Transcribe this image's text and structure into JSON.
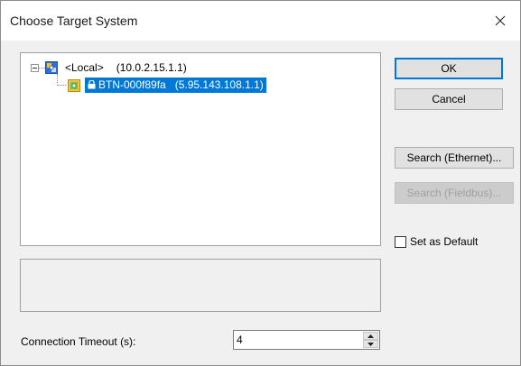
{
  "window": {
    "title": "Choose Target System",
    "close_icon": "close-icon"
  },
  "tree": {
    "root": {
      "label": "<Local>",
      "address": "(10.0.2.15.1.1)",
      "icon": "computer-icon"
    },
    "child": {
      "label": "BTN-000f89fa",
      "address": "(5.95.143.108.1.1)",
      "icon": "remote-system-icon",
      "selected": true
    }
  },
  "buttons": {
    "ok": "OK",
    "cancel": "Cancel",
    "search_ethernet": "Search (Ethernet)...",
    "search_fieldbus": "Search (Fieldbus)..."
  },
  "set_default": {
    "label": "Set as Default",
    "checked": false
  },
  "timeout": {
    "label": "Connection Timeout (s):",
    "value": "4"
  },
  "colors": {
    "selection": "#0078d7",
    "dialog_bg": "#f0f0f0"
  }
}
